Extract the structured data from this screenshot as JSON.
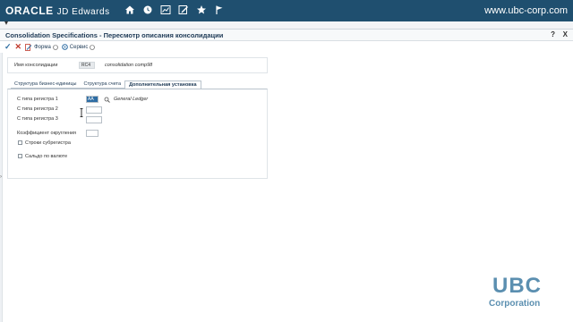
{
  "header": {
    "brand_oracle": "ORACLE",
    "brand_jde": "JD Edwards",
    "site": "www.ubc-corp.com",
    "icons": [
      "home-icon",
      "clock-icon",
      "chart-icon",
      "edit-icon",
      "star-icon",
      "flag-icon"
    ]
  },
  "window": {
    "title": "Consolidation Specifications - Пересмотр описания консолидации",
    "help": "?",
    "close": "X"
  },
  "toolbar": {
    "form_label": "Форма",
    "services_label": "Сервис"
  },
  "form": {
    "consolidation_name_label": "Имя консолидации",
    "consolidation_code": "RC4",
    "consolidation_description": "consolidation comp98"
  },
  "tabs": [
    {
      "label": "Структура бизнес-единицы",
      "active": false
    },
    {
      "label": "Структура счета",
      "active": false
    },
    {
      "label": "Дополнительная установка",
      "active": true
    }
  ],
  "fields": {
    "ledger1_label": "С типа регистра 1",
    "ledger1_value": "AA",
    "ledger1_desc": "General Ledger",
    "ledger2_label": "С типа регистра 2",
    "ledger3_label": "С типа регистра 3",
    "rounding_label": "Коэффициент округления",
    "subledger_label": "Строки субрегистра",
    "currency_label": "Сальдо по валюте"
  },
  "logo": {
    "text": "UBC",
    "subtitle": "Corporation"
  },
  "colors": {
    "topbar": "#1f4f6f",
    "accent": "#5b8fb0"
  }
}
